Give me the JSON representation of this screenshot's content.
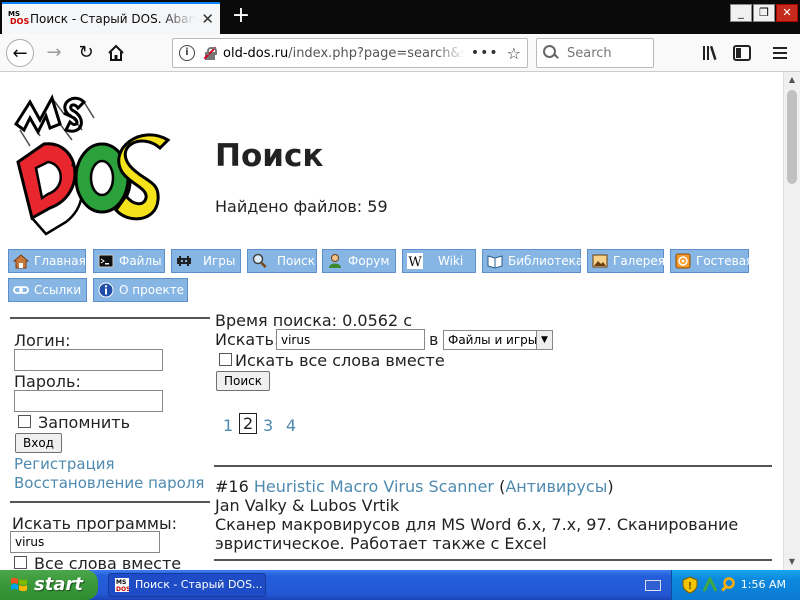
{
  "browser": {
    "tab_title": "Поиск - Старый DOS. Abandonware",
    "url_host": "old-dos.ru",
    "url_path": "/index.php?page=search&s",
    "search_placeholder": "Search"
  },
  "logo": {
    "top_text": "MS",
    "main_text": "DOS"
  },
  "page": {
    "title": "Поиск",
    "files_found": "Найдено файлов: 59"
  },
  "menu": [
    {
      "label": "Главная"
    },
    {
      "label": "Файлы"
    },
    {
      "label": "Игры"
    },
    {
      "label": "Поиск"
    },
    {
      "label": "Форум"
    },
    {
      "label": "Wiki"
    },
    {
      "label": "Библиотека"
    },
    {
      "label": "Галерея"
    },
    {
      "label": "Гостевая"
    },
    {
      "label": "Ссылки"
    },
    {
      "label": "О проекте"
    }
  ],
  "sidebar": {
    "login_label": "Логин:",
    "password_label": "Пароль:",
    "remember_label": "Запомнить",
    "login_button": "Вход",
    "register_link": "Регистрация",
    "restore_link": "Восстановление пароля",
    "search_label": "Искать программы:",
    "search_value": "virus",
    "all_words_label": "Все слова вместе"
  },
  "search": {
    "time": "Время поиска: 0.0562 с",
    "search_label": "Искать:",
    "query": "virus",
    "in_label": "в",
    "scope_selected": "Файлы и игры",
    "all_words_label": "Искать все слова вместе",
    "button": "Поиск",
    "pages": [
      "1",
      "2",
      "3",
      "4"
    ],
    "current_page": "2"
  },
  "results": [
    {
      "number": "#16",
      "title": "Heuristic Macro Virus Scanner",
      "category": "Антивирусы",
      "authors": "Jan Valky & Lubos Vrtik",
      "description_line1": "Сканер макровирусов для MS Word 6.x, 7.x, 97. Сканирование",
      "description_line2": "эвристическое. Работает также с Excel"
    }
  ],
  "taskbar": {
    "start_label": "start",
    "task_label": "Поиск - Старый DOS...",
    "clock": "1:56 AM"
  },
  "colors": {
    "link": "#4e8ab0",
    "menu_button": "#87b6e4",
    "taskbar": "#245edb",
    "start_button": "#3c9a3c"
  }
}
